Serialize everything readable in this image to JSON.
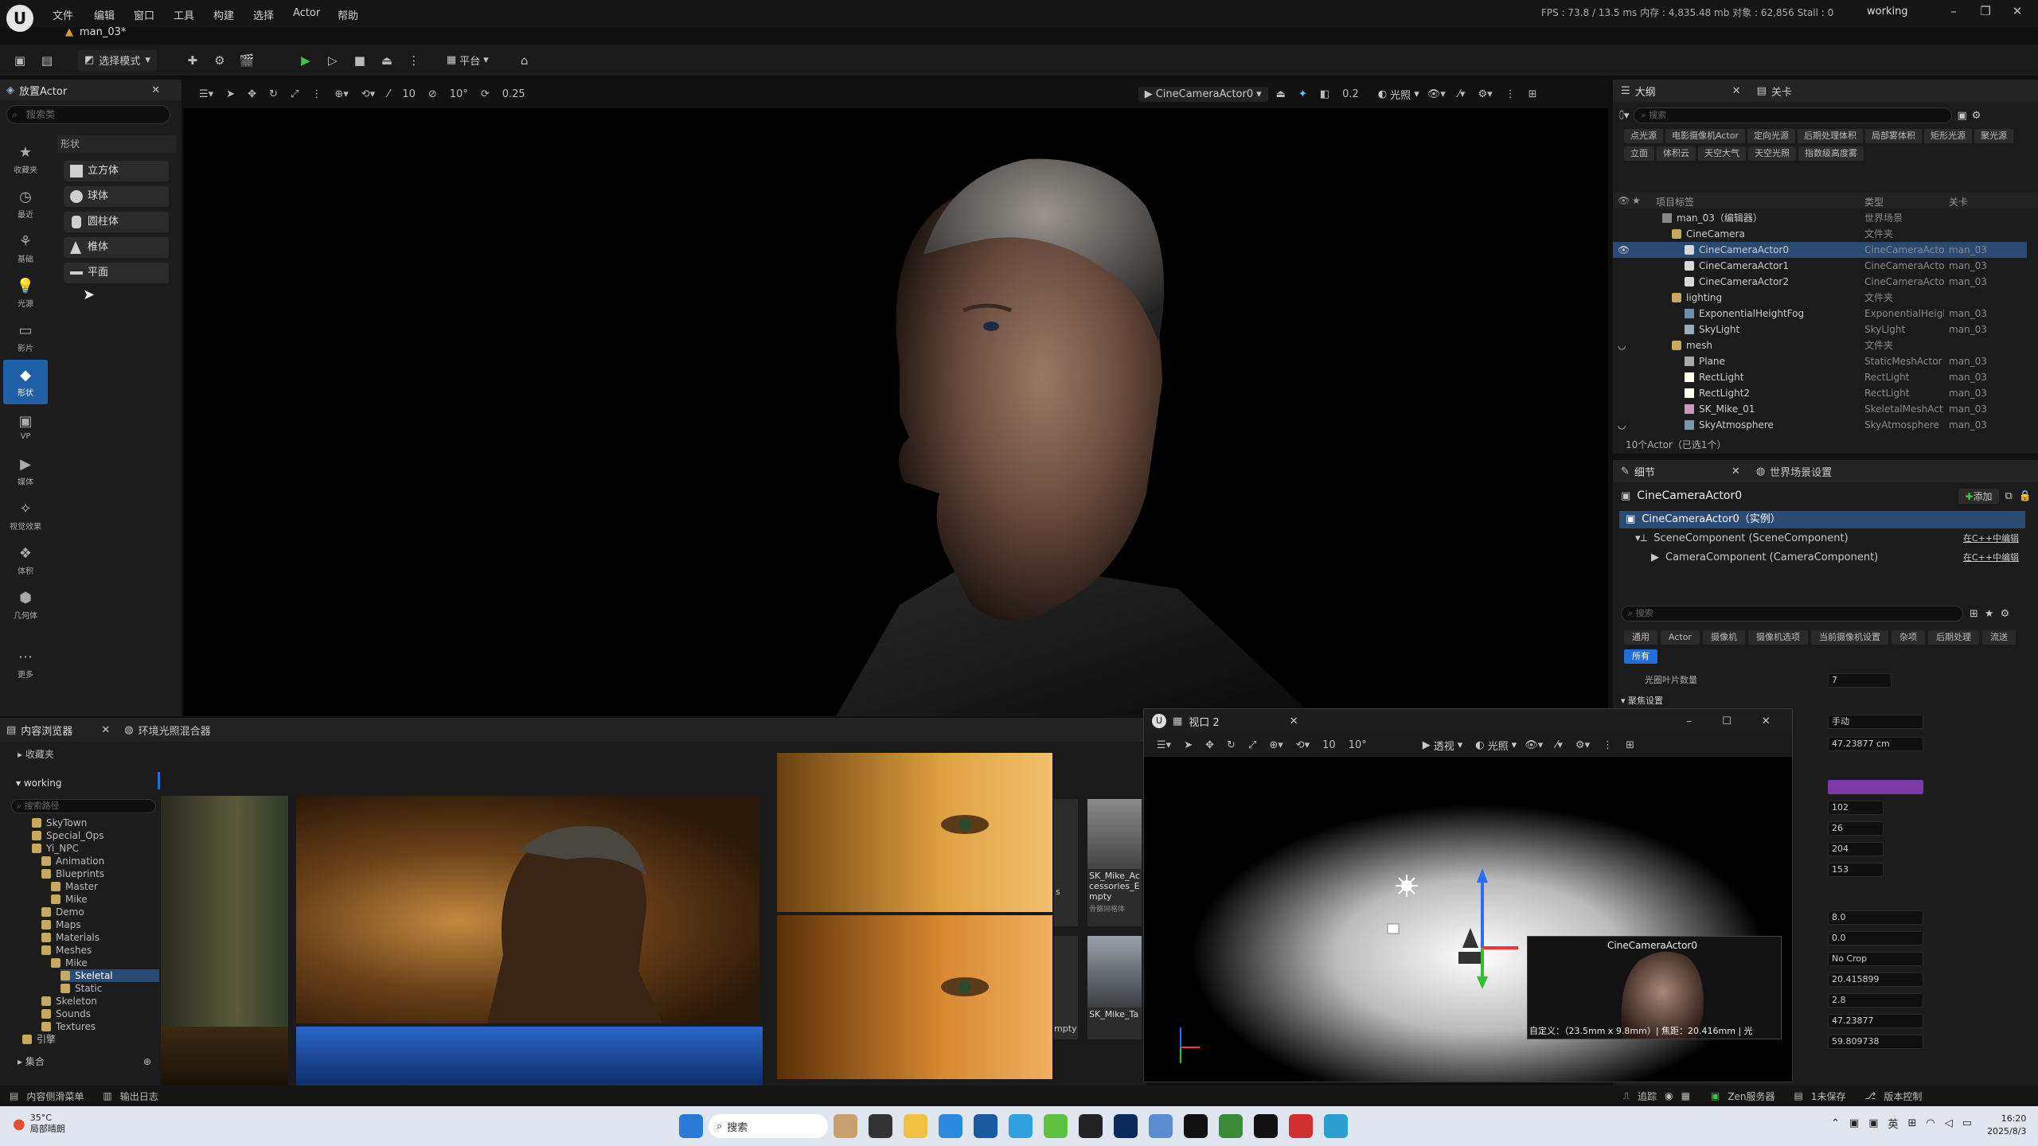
{
  "menubar": {
    "items": [
      "文件",
      "编辑",
      "窗口",
      "工具",
      "构建",
      "选择",
      "Actor",
      "帮助"
    ],
    "document_tab": "man_03*",
    "stats": "FPS : 73.8 / 13.5 ms  内存 : 4,835.48 mb  对象 : 62,856  Stall : 0",
    "project": "working"
  },
  "toolbar": {
    "select_mode": "选择模式",
    "platform": "平台"
  },
  "place_actor": {
    "tab": "放置Actor",
    "search_placeholder": "搜索类",
    "categories": [
      {
        "icon": "star-icon",
        "label": "收藏夹"
      },
      {
        "icon": "clock-icon",
        "label": "最近"
      },
      {
        "icon": "basic-icon",
        "label": "基础"
      },
      {
        "icon": "bulb-icon",
        "label": "光源"
      },
      {
        "icon": "film-icon",
        "label": "影片"
      },
      {
        "icon": "shape-icon",
        "label": "形状"
      },
      {
        "icon": "vp-icon",
        "label": "VP"
      },
      {
        "icon": "visual-effects-icon",
        "label": "视觉效果"
      },
      {
        "icon": "volume-icon",
        "label": "体积"
      },
      {
        "icon": "geometry-icon",
        "label": "几何体"
      },
      {
        "icon": "more-icon",
        "label": "更多"
      }
    ],
    "section": "形状",
    "shapes": [
      "立方体",
      "球体",
      "圆柱体",
      "椎体",
      "平面"
    ]
  },
  "viewport": {
    "camera": "CineCameraActor0",
    "snap_move": "10",
    "snap_rot": "10°",
    "snap_scale": "0.25",
    "speed": "0.2",
    "lit": "光照"
  },
  "outliner": {
    "tabs": [
      "大纲",
      "关卡"
    ],
    "search_placeholder": "搜索",
    "filters_row1": [
      "点光源",
      "电影摄像机Actor",
      "定向光源",
      "后期处理体积",
      "局部雾体积"
    ],
    "filters_row2": [
      "矩形光源",
      "聚光源",
      "立面",
      "体积云",
      "天空大气",
      "天空光照"
    ],
    "filters_row3": [
      "指数级高度雾"
    ],
    "col_label": "项目标签",
    "col_type": "类型",
    "col_level": "关卡",
    "rows": [
      {
        "name": "man_03（编辑器）",
        "type": "世界场景",
        "level": ""
      },
      {
        "name": "CineCamera",
        "type": "文件夹",
        "level": ""
      },
      {
        "name": "CineCameraActor0",
        "type": "CineCameraActo",
        "level": "man_03"
      },
      {
        "name": "CineCameraActor1",
        "type": "CineCameraActo",
        "level": "man_03"
      },
      {
        "name": "CineCameraActor2",
        "type": "CineCameraActo",
        "level": "man_03"
      },
      {
        "name": "lighting",
        "type": "文件夹",
        "level": ""
      },
      {
        "name": "ExponentialHeightFog",
        "type": "ExponentialHeigh",
        "level": "man_03"
      },
      {
        "name": "SkyLight",
        "type": "SkyLight",
        "level": "man_03"
      },
      {
        "name": "mesh",
        "type": "文件夹",
        "level": ""
      },
      {
        "name": "Plane",
        "type": "StaticMeshActor",
        "level": "man_03"
      },
      {
        "name": "RectLight",
        "type": "RectLight",
        "level": "man_03"
      },
      {
        "name": "RectLight2",
        "type": "RectLight",
        "level": "man_03"
      },
      {
        "name": "SK_Mike_01",
        "type": "SkeletalMeshAct",
        "level": "man_03"
      },
      {
        "name": "SkyAtmosphere",
        "type": "SkyAtmosphere",
        "level": "man_03"
      }
    ],
    "footer": "10个Actor（已选1个）"
  },
  "details": {
    "tabs": [
      "细节",
      "世界场景设置"
    ],
    "title": "CineCameraActor0",
    "add_button": "添加",
    "instance": "CineCameraActor0（实例）",
    "components": [
      {
        "name": "SceneComponent (SceneComponent)",
        "link": "在C++中编辑"
      },
      {
        "name": "CameraComponent (CameraComponent)",
        "link": "在C++中编辑"
      }
    ],
    "search_placeholder": "搜索",
    "cat_row1": [
      "通用",
      "Actor",
      "摄像机",
      "摄像机选项",
      "当前摄像机设置",
      "杂项"
    ],
    "cat_row2": [
      "后期处理",
      "流送",
      "所有"
    ],
    "section": "聚焦设置",
    "frame_label": "光圈叶片数量",
    "frame_value": "7",
    "values": [
      "手动",
      "47.23877 cm",
      "102",
      "26",
      "204",
      "153",
      "8.0",
      "0.0",
      "No Crop",
      "20.415899",
      "2.8",
      "47.23877",
      "59.809738"
    ]
  },
  "content_browser": {
    "tabs": [
      "内容浏览器",
      "环境光照混合器"
    ],
    "favorites": "收藏夹",
    "root": "working",
    "search_placeholder": "搜索路径",
    "tree": [
      "SkyTown",
      "Special_Ops",
      "Yi_NPC",
      "Animation",
      "Blueprints",
      "Master",
      "Mike",
      "Demo",
      "Maps",
      "Materials",
      "Meshes",
      "Mike",
      "Skeletal",
      "Static",
      "Skeleton",
      "Sounds",
      "Textures",
      "引擎"
    ],
    "collections": "集合",
    "assets": [
      {
        "name": "SK_Mike_Accessories_Empty",
        "sub": "骨骼网格体"
      },
      {
        "name": "SK_Mike_Ta",
        "sub": ""
      }
    ],
    "left_asset_fragment": "s",
    "left_asset_fragment2": "mpty"
  },
  "viewport2": {
    "title": "视口 2",
    "snap_move": "10",
    "snap_rot": "10°",
    "view": "透视",
    "lit": "光照",
    "pip_title": "CineCameraActor0",
    "pip_caption": "自定义：（23.5mm x 9.8mm）| 焦距：20.416mm | 光"
  },
  "statusbar": {
    "content_drawer": "内容侧滑菜单",
    "output_log": "输出日志",
    "tracking": "追踪",
    "zen": "Zen服务器",
    "unsaved": "1未保存",
    "version": "版本控制"
  },
  "taskbar": {
    "weather_temp": "35°C",
    "weather_text": "局部晴朗",
    "search": "搜索",
    "time": "16:20",
    "date": "2025/8/3",
    "ime": "英"
  }
}
